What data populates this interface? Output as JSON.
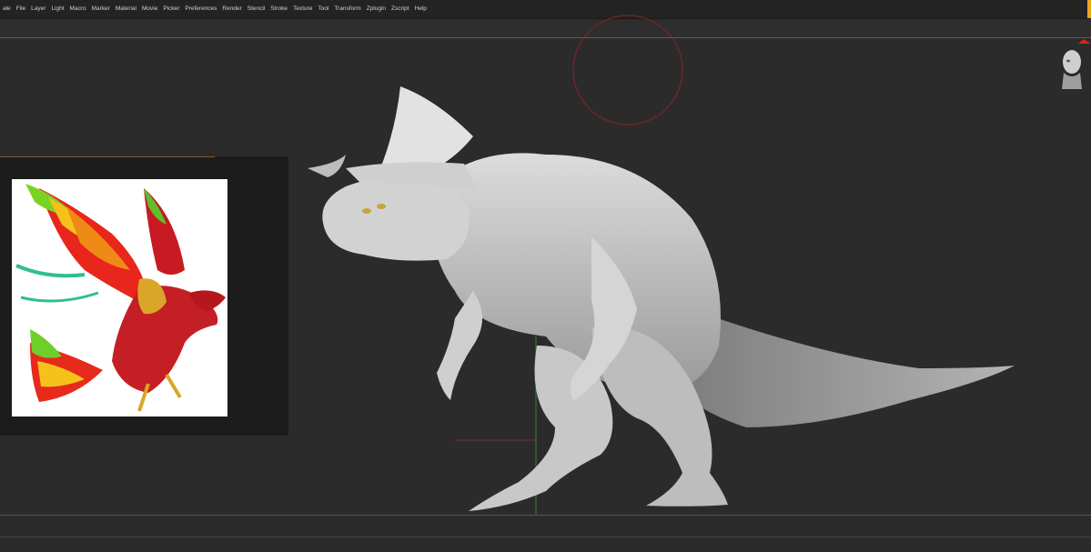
{
  "menu": {
    "items": [
      "ale",
      "File",
      "Layer",
      "Light",
      "Macro",
      "Marker",
      "Material",
      "Movie",
      "Picker",
      "Preferences",
      "Render",
      "Stencil",
      "Stroke",
      "Texture",
      "Tool",
      "Transform",
      "Zplugin",
      "Zscript",
      "Help"
    ]
  },
  "icons": {
    "navigation_gizmo": "head-navigation-icon",
    "axis_indicator": "red-arrow-icon"
  },
  "colors": {
    "background": "#2b2b2b",
    "menubar": "#232323",
    "brush_cursor": "#b0281f",
    "model": "#c9c9c9",
    "accent": "#f2a21b"
  }
}
